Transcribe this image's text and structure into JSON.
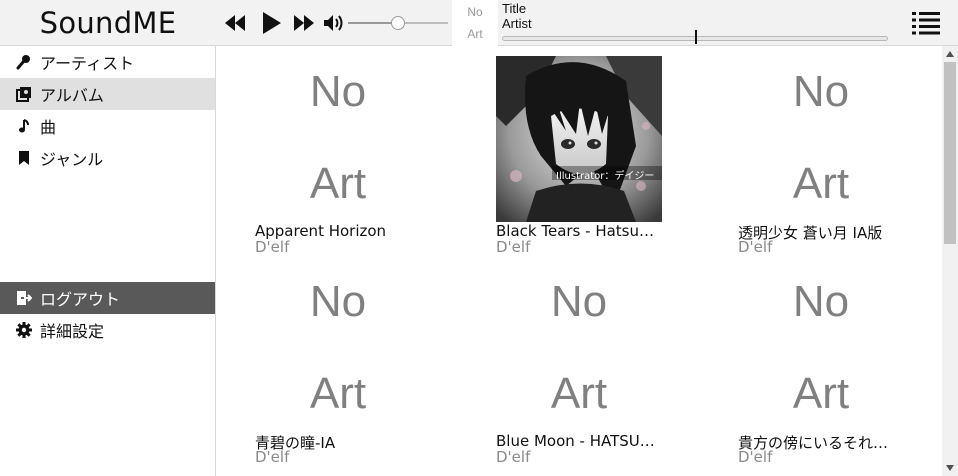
{
  "app": {
    "title": "SoundME"
  },
  "player": {
    "volume_percent": 50,
    "seek_percent": 50,
    "now_playing": {
      "art_line1": "No",
      "art_line2": "Art",
      "title": "Title",
      "artist": "Artist"
    }
  },
  "sidebar": {
    "items": [
      {
        "label": "アーティスト",
        "icon": "microphone-icon"
      },
      {
        "label": "アルバム",
        "icon": "album-icon",
        "active": true
      },
      {
        "label": "曲",
        "icon": "music-note-icon"
      },
      {
        "label": "ジャンル",
        "icon": "bookmark-icon"
      }
    ],
    "logout": {
      "label": "ログアウト",
      "icon": "logout-icon"
    },
    "settings": {
      "label": "詳細設定",
      "icon": "gear-icon"
    }
  },
  "albums": [
    {
      "title": "Apparent Horizon",
      "artist": "D'elf",
      "has_art": false,
      "art_line1": "No",
      "art_line2": "Art"
    },
    {
      "title": "Black Tears - Hatsune Miku",
      "artist": "D'elf",
      "has_art": true,
      "art_caption": "Illustrator：デイジー",
      "art_line1": "",
      "art_line2": ""
    },
    {
      "title": "透明少女 蒼い月 IA版",
      "artist": "D'elf",
      "has_art": false,
      "art_line1": "No",
      "art_line2": "Art"
    },
    {
      "title": "青碧の瞳-IA",
      "artist": "D'elf",
      "has_art": false,
      "art_line1": "No",
      "art_line2": "Art"
    },
    {
      "title": "Blue Moon - HATSUNE MIKU",
      "artist": "D'elf",
      "has_art": false,
      "art_line1": "No",
      "art_line2": "Art"
    },
    {
      "title": "貴方の傍にいるそれだけで",
      "artist": "D'elf",
      "has_art": false,
      "art_line1": "No",
      "art_line2": "Art"
    }
  ],
  "colors": {
    "header_bg": "#f2f2f2",
    "active_nav": "#e0e0e0",
    "logout_bg": "#595959",
    "no_art_text": "#808080",
    "artist_text": "#8a8a8a"
  }
}
